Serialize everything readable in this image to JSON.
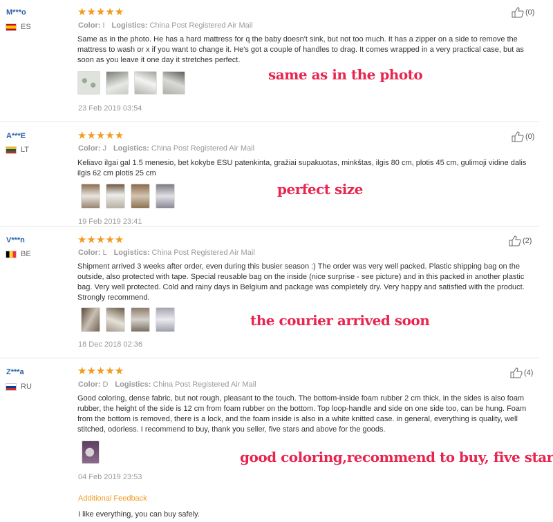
{
  "colors": {
    "star": "#f39a1f",
    "username": "#2962a8",
    "overlay_text": "#e8254f",
    "meta": "#999999"
  },
  "meta_labels": {
    "color": "Color:",
    "logistics": "Logistics:"
  },
  "icons": {
    "rating": "star-icon",
    "helpful": "thumbs-up-icon"
  },
  "reviews": [
    {
      "user": "M***o",
      "country": "ES",
      "stars": "★★★★★",
      "rating": 5,
      "color_value": "I",
      "logistics_value": "China Post Registered Air Mail",
      "text": "Same as in the photo. He has a hard mattress for q the baby doesn't sink, but not too much. It has a zipper on a side to remove the mattress to wash or x if you want to change it. He's got a couple of handles to drag. It comes wrapped in a very practical case, but as soon as you leave it one day it stretches perfect.",
      "overlay": "same as in the photo",
      "date": "23 Feb 2019 03:54",
      "helpful": "(0)"
    },
    {
      "user": "A***E",
      "country": "LT",
      "stars": "★★★★★",
      "rating": 5,
      "color_value": "J",
      "logistics_value": "China Post Registered Air Mail",
      "text": "Keliavo ilgai gal 1.5 menesio, bet kokybe ESU patenkinta, gražiai supakuotas, minkštas, ilgis 80 cm, plotis 45 cm, gulimoji vidine dalis ilgis 62 cm plotis 25 cm",
      "overlay": "perfect size",
      "date": "19 Feb 2019 23:41",
      "helpful": "(0)"
    },
    {
      "user": "V***n",
      "country": "BE",
      "stars": "★★★★★",
      "rating": 5,
      "color_value": "L",
      "logistics_value": "China Post Registered Air Mail",
      "text": "Shipment arrived 3 weeks after order, even during this busier season :) The order was very well packed. Plastic shipping bag on the outside, also protected with tape. Special reusable bag on the inside (nice surprise - see picture) and in this packed in another plastic bag. Very well protected. Cold and rainy days in Belgium and package was completely dry. Very happy and satisfied with the product. Strongly recommend.",
      "overlay": "the courier arrived soon",
      "date": "18 Dec 2018 02:36",
      "helpful": "(2)"
    },
    {
      "user": "Z***a",
      "country": "RU",
      "stars": "★★★★★",
      "rating": 5,
      "color_value": "D",
      "logistics_value": "China Post Registered Air Mail",
      "text": "Good coloring, dense fabric, but not rough, pleasant to the touch. The bottom-inside foam rubber 2 cm thick, in the sides is also foam rubber, the height of the side is 12 cm from foam rubber on the bottom. Top loop-handle and side on one side too, can be hung. Foam from the bottom is removed, there is a lock, and the foam inside is also in a white knitted case. in general, everything is quality, well stitched, odorless. I recommend to buy, thank you seller, five stars and above for the goods.",
      "overlay": "good coloring,recommend to buy, five star",
      "date": "04 Feb 2019 23:53",
      "helpful": "(4)",
      "additional_title": "Additional Feedback",
      "additional_text": "I like everything, you can buy safely."
    }
  ]
}
